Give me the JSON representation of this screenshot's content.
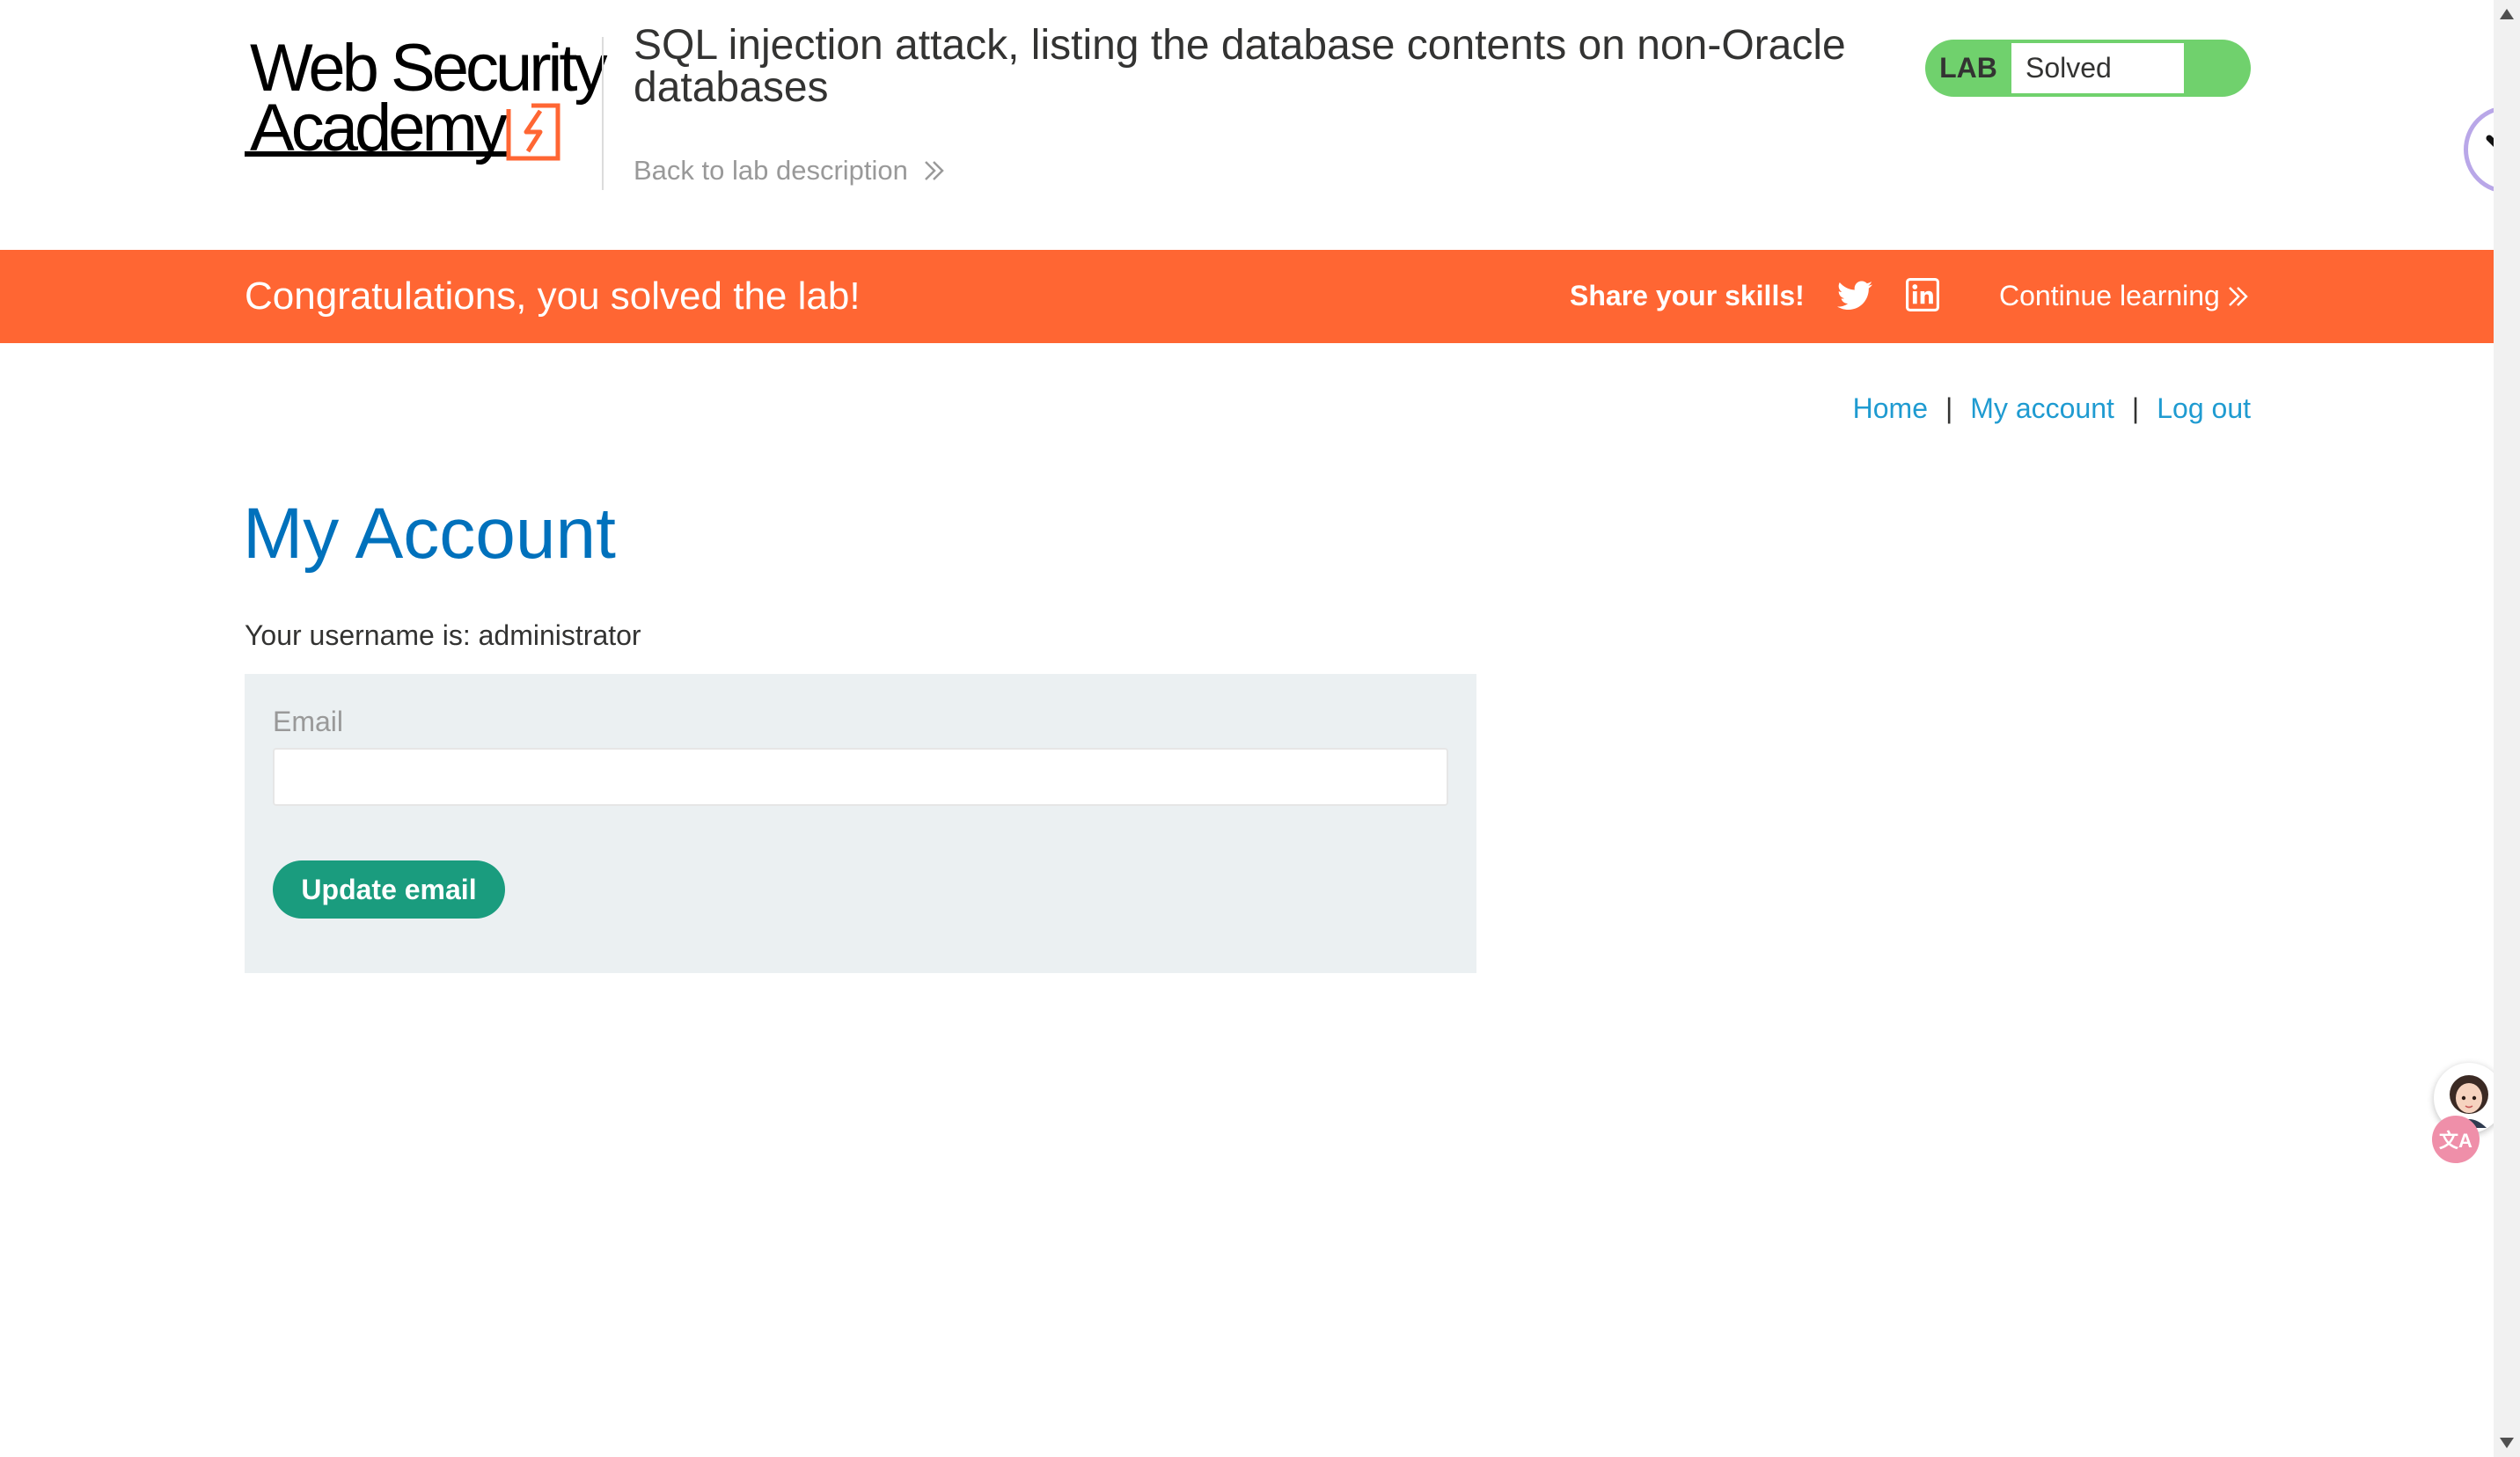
{
  "header": {
    "logo_line1": "Web Security",
    "logo_line2": "Academy",
    "lab_title": "SQL injection attack, listing the database contents on non-Oracle databases",
    "back_link": "Back to lab description",
    "status_widget": {
      "label": "LAB",
      "status": "Solved"
    }
  },
  "banner": {
    "message": "Congratulations, you solved the lab!",
    "share_label": "Share your skills!",
    "continue_label": "Continue learning",
    "icons": [
      "twitter-icon",
      "linkedin-icon"
    ]
  },
  "nav": {
    "home": "Home",
    "my_account": "My account",
    "logout": "Log out",
    "separator": "|"
  },
  "main": {
    "title": "My Account",
    "username_text": "Your username is: administrator",
    "email_label": "Email",
    "email_value": "",
    "update_button": "Update email"
  },
  "floating": {
    "translate_badge": "文A"
  },
  "colors": {
    "brand_orange": "#ff6633",
    "solved_green": "#70d16d",
    "title_blue": "#0071bc",
    "link_blue": "#1f9bd1",
    "button_teal": "#1a9c7e",
    "form_bg": "#ebf0f2"
  }
}
